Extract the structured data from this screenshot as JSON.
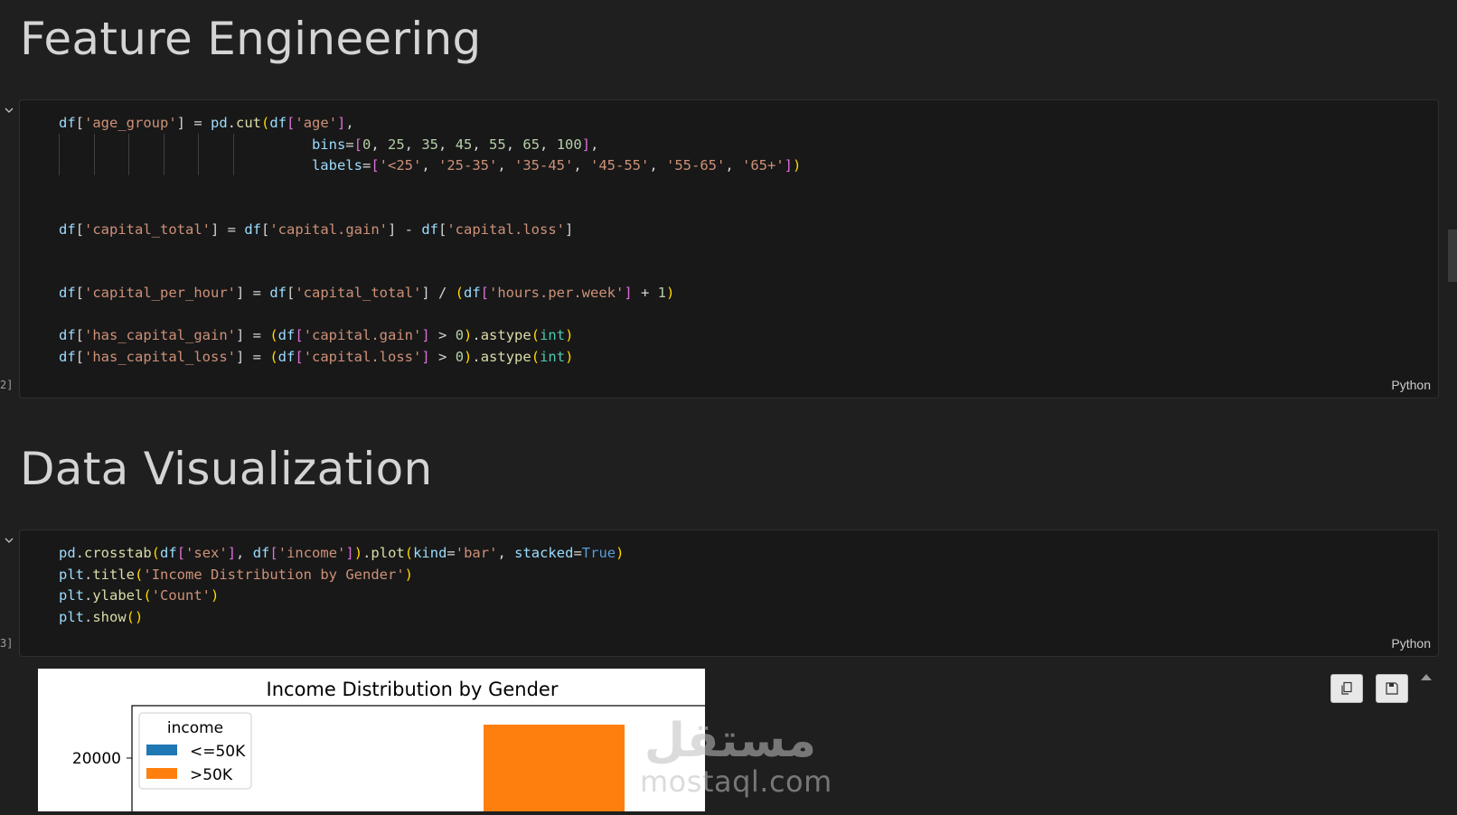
{
  "sections": {
    "feature_heading": "Feature Engineering",
    "viz_heading": "Data Visualization"
  },
  "cell1": {
    "exec_count": "2]",
    "language": "Python",
    "lines": [
      [
        [
          "v",
          "df"
        ],
        [
          "p",
          "["
        ],
        [
          "s",
          "'age_group'"
        ],
        [
          "p",
          "] = "
        ],
        [
          "v",
          "pd"
        ],
        [
          "p",
          "."
        ],
        [
          "f",
          "cut"
        ],
        [
          "b1",
          "("
        ],
        [
          "v",
          "df"
        ],
        [
          "b2",
          "["
        ],
        [
          "s",
          "'age'"
        ],
        [
          "b2",
          "]"
        ],
        [
          "p",
          ","
        ]
      ],
      [
        [
          "p",
          "                              "
        ],
        [
          "v",
          "bins"
        ],
        [
          "p",
          "="
        ],
        [
          "b2",
          "["
        ],
        [
          "n",
          "0"
        ],
        [
          "p",
          ", "
        ],
        [
          "n",
          "25"
        ],
        [
          "p",
          ", "
        ],
        [
          "n",
          "35"
        ],
        [
          "p",
          ", "
        ],
        [
          "n",
          "45"
        ],
        [
          "p",
          ", "
        ],
        [
          "n",
          "55"
        ],
        [
          "p",
          ", "
        ],
        [
          "n",
          "65"
        ],
        [
          "p",
          ", "
        ],
        [
          "n",
          "100"
        ],
        [
          "b2",
          "]"
        ],
        [
          "p",
          ","
        ]
      ],
      [
        [
          "p",
          "                              "
        ],
        [
          "v",
          "labels"
        ],
        [
          "p",
          "="
        ],
        [
          "b2",
          "["
        ],
        [
          "s",
          "'<25'"
        ],
        [
          "p",
          ", "
        ],
        [
          "s",
          "'25-35'"
        ],
        [
          "p",
          ", "
        ],
        [
          "s",
          "'35-45'"
        ],
        [
          "p",
          ", "
        ],
        [
          "s",
          "'45-55'"
        ],
        [
          "p",
          ", "
        ],
        [
          "s",
          "'55-65'"
        ],
        [
          "p",
          ", "
        ],
        [
          "s",
          "'65+'"
        ],
        [
          "b2",
          "]"
        ],
        [
          "b1",
          ")"
        ]
      ],
      [],
      [],
      [
        [
          "v",
          "df"
        ],
        [
          "p",
          "["
        ],
        [
          "s",
          "'capital_total'"
        ],
        [
          "p",
          "] = "
        ],
        [
          "v",
          "df"
        ],
        [
          "p",
          "["
        ],
        [
          "s",
          "'capital.gain'"
        ],
        [
          "p",
          "] - "
        ],
        [
          "v",
          "df"
        ],
        [
          "p",
          "["
        ],
        [
          "s",
          "'capital.loss'"
        ],
        [
          "p",
          "]"
        ]
      ],
      [],
      [],
      [
        [
          "v",
          "df"
        ],
        [
          "p",
          "["
        ],
        [
          "s",
          "'capital_per_hour'"
        ],
        [
          "p",
          "] = "
        ],
        [
          "v",
          "df"
        ],
        [
          "p",
          "["
        ],
        [
          "s",
          "'capital_total'"
        ],
        [
          "p",
          "] / "
        ],
        [
          "b1",
          "("
        ],
        [
          "v",
          "df"
        ],
        [
          "b2",
          "["
        ],
        [
          "s",
          "'hours.per.week'"
        ],
        [
          "b2",
          "]"
        ],
        [
          "p",
          " + "
        ],
        [
          "n",
          "1"
        ],
        [
          "b1",
          ")"
        ]
      ],
      [],
      [
        [
          "v",
          "df"
        ],
        [
          "p",
          "["
        ],
        [
          "s",
          "'has_capital_gain'"
        ],
        [
          "p",
          "] = "
        ],
        [
          "b1",
          "("
        ],
        [
          "v",
          "df"
        ],
        [
          "b2",
          "["
        ],
        [
          "s",
          "'capital.gain'"
        ],
        [
          "b2",
          "]"
        ],
        [
          "p",
          " > "
        ],
        [
          "n",
          "0"
        ],
        [
          "b1",
          ")"
        ],
        [
          "p",
          "."
        ],
        [
          "f",
          "astype"
        ],
        [
          "b1",
          "("
        ],
        [
          "t",
          "int"
        ],
        [
          "b1",
          ")"
        ]
      ],
      [
        [
          "v",
          "df"
        ],
        [
          "p",
          "["
        ],
        [
          "s",
          "'has_capital_loss'"
        ],
        [
          "p",
          "] = "
        ],
        [
          "b1",
          "("
        ],
        [
          "v",
          "df"
        ],
        [
          "b2",
          "["
        ],
        [
          "s",
          "'capital.loss'"
        ],
        [
          "b2",
          "]"
        ],
        [
          "p",
          " > "
        ],
        [
          "n",
          "0"
        ],
        [
          "b1",
          ")"
        ],
        [
          "p",
          "."
        ],
        [
          "f",
          "astype"
        ],
        [
          "b1",
          "("
        ],
        [
          "t",
          "int"
        ],
        [
          "b1",
          ")"
        ]
      ]
    ]
  },
  "cell2": {
    "exec_count": "3]",
    "language": "Python",
    "lines": [
      [
        [
          "v",
          "pd"
        ],
        [
          "p",
          "."
        ],
        [
          "f",
          "crosstab"
        ],
        [
          "b1",
          "("
        ],
        [
          "v",
          "df"
        ],
        [
          "b2",
          "["
        ],
        [
          "s",
          "'sex'"
        ],
        [
          "b2",
          "]"
        ],
        [
          "p",
          ", "
        ],
        [
          "v",
          "df"
        ],
        [
          "b2",
          "["
        ],
        [
          "s",
          "'income'"
        ],
        [
          "b2",
          "]"
        ],
        [
          "b1",
          ")"
        ],
        [
          "p",
          "."
        ],
        [
          "f",
          "plot"
        ],
        [
          "b1",
          "("
        ],
        [
          "v",
          "kind"
        ],
        [
          "p",
          "="
        ],
        [
          "s",
          "'bar'"
        ],
        [
          "p",
          ", "
        ],
        [
          "v",
          "stacked"
        ],
        [
          "p",
          "="
        ],
        [
          "k",
          "True"
        ],
        [
          "b1",
          ")"
        ]
      ],
      [
        [
          "v",
          "plt"
        ],
        [
          "p",
          "."
        ],
        [
          "f",
          "title"
        ],
        [
          "b1",
          "("
        ],
        [
          "s",
          "'Income Distribution by Gender'"
        ],
        [
          "b1",
          ")"
        ]
      ],
      [
        [
          "v",
          "plt"
        ],
        [
          "p",
          "."
        ],
        [
          "f",
          "ylabel"
        ],
        [
          "b1",
          "("
        ],
        [
          "s",
          "'Count'"
        ],
        [
          "b1",
          ")"
        ]
      ],
      [
        [
          "v",
          "plt"
        ],
        [
          "p",
          "."
        ],
        [
          "f",
          "show"
        ],
        [
          "b1",
          "()"
        ]
      ]
    ]
  },
  "chart_data": {
    "type": "bar",
    "title": "Income Distribution by Gender",
    "legend_title": "income",
    "legend_position": "upper-left",
    "series": [
      {
        "name": "<=50K",
        "color": "#1f77b4"
      },
      {
        "name": ">50K",
        "color": "#ff7f0e"
      }
    ],
    "y_ticks": [
      "20000"
    ],
    "visible_bar_series": ">50K"
  },
  "watermark": {
    "arabic": "مستقل",
    "latin": "mostaql.com"
  },
  "icons": {
    "collapse": "chevron-down-icon",
    "copy": "copy-icon",
    "save": "save-icon",
    "scroll_up": "collapse-up-icon"
  }
}
